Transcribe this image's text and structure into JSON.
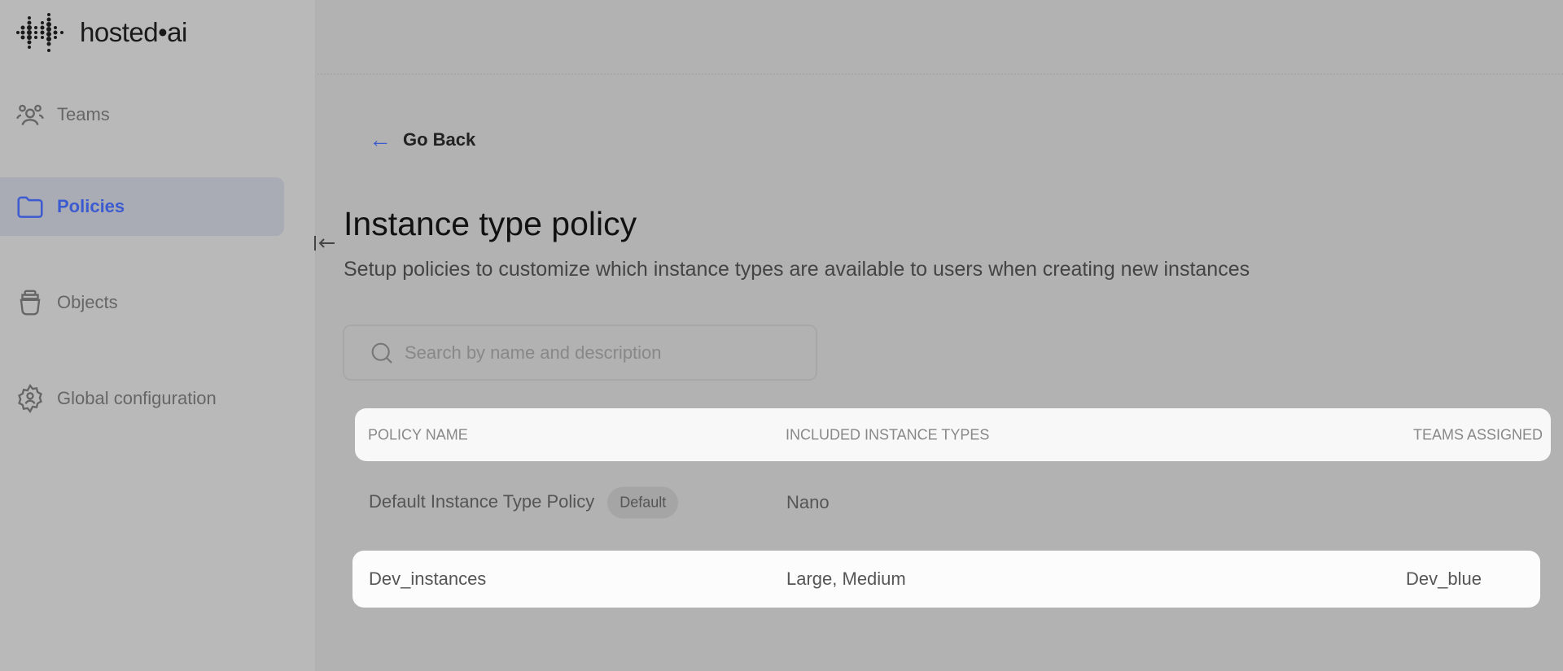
{
  "brand": {
    "name": "hosted•ai"
  },
  "sidebar": {
    "items": [
      {
        "label": "Teams",
        "icon": "users-icon",
        "active": false
      },
      {
        "label": "Policies",
        "icon": "folder-icon",
        "active": true
      },
      {
        "label": "Objects",
        "icon": "jar-icon",
        "active": false
      },
      {
        "label": "Global configuration",
        "icon": "gear-icon",
        "active": false
      }
    ]
  },
  "main": {
    "go_back": "Go Back",
    "title": "Instance type policy",
    "subtitle": "Setup policies to customize which instance types are available to users when creating new instances",
    "search": {
      "placeholder": "Search by name and description",
      "value": ""
    }
  },
  "table": {
    "headers": [
      "POLICY NAME",
      "INCLUDED INSTANCE TYPES",
      "TEAMS ASSIGNED"
    ],
    "rows": [
      {
        "name": "Default Instance Type Policy",
        "badge": "Default",
        "types": "Nano",
        "teams": ""
      },
      {
        "name": "Dev_instances",
        "badge": "",
        "types": "Large, Medium",
        "teams": "Dev_blue"
      }
    ]
  },
  "colors": {
    "accent": "#3d5bd1",
    "overlay": "#b2b2b2"
  }
}
